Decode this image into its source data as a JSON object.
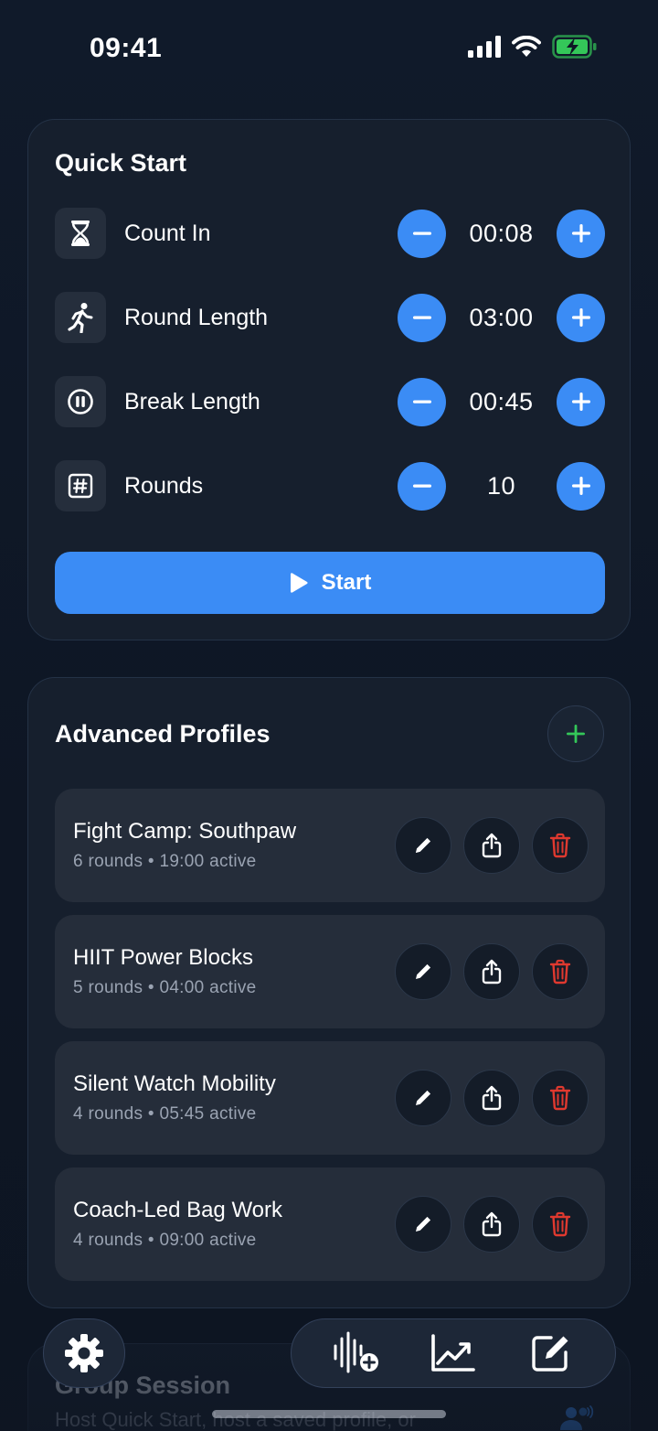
{
  "status_bar": {
    "time": "09:41",
    "icons": [
      "cellular-signal-icon",
      "wifi-icon",
      "battery-charging-icon"
    ],
    "battery_color": "#34c759"
  },
  "quick_start": {
    "title": "Quick Start",
    "rows": [
      {
        "label": "Count In",
        "value": "00:08",
        "icon": "hourglass-icon"
      },
      {
        "label": "Round Length",
        "value": "03:00",
        "icon": "runner-icon"
      },
      {
        "label": "Break Length",
        "value": "00:45",
        "icon": "pause-circle-icon"
      },
      {
        "label": "Rounds",
        "value": "10",
        "icon": "number-sign-icon"
      }
    ],
    "start_label": "Start"
  },
  "advanced_profiles": {
    "title": "Advanced Profiles",
    "profiles": [
      {
        "name": "Fight Camp: Southpaw",
        "meta": "6 rounds • 19:00 active"
      },
      {
        "name": "HIIT Power Blocks",
        "meta": "5 rounds • 04:00 active"
      },
      {
        "name": "Silent Watch Mobility",
        "meta": "4 rounds • 05:45 active"
      },
      {
        "name": "Coach-Led Bag Work",
        "meta": "4 rounds • 09:00 active"
      }
    ]
  },
  "group_session": {
    "title": "Group Session",
    "subtitle": "Host Quick Start, host a saved profile, or"
  },
  "bottom_nav": {
    "items": [
      "settings-gear-icon",
      "audio-add-icon",
      "chart-trend-icon",
      "edit-note-icon"
    ]
  },
  "colors": {
    "accent": "#3b8cf5",
    "add": "#34c759",
    "delete": "#e0392f",
    "card": "#161f2d",
    "profile_card": "#252d3a"
  }
}
